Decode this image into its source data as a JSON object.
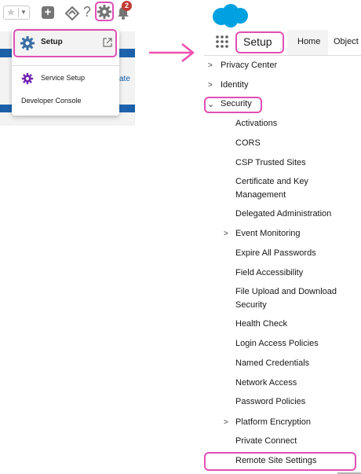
{
  "left": {
    "notification_count": "2",
    "peek_text": "ate",
    "menu": {
      "setup_label": "Setup",
      "service_setup_label": "Service Setup",
      "developer_console_label": "Developer Console"
    }
  },
  "right": {
    "header_title": "Setup",
    "tabs": [
      "Home",
      "Object"
    ],
    "tree": [
      {
        "label": "Privacy Center",
        "level": 0,
        "chevron": "right"
      },
      {
        "label": "Identity",
        "level": 0,
        "chevron": "right"
      },
      {
        "label": "Security",
        "level": 0,
        "chevron": "down"
      },
      {
        "label": "Activations",
        "level": 1
      },
      {
        "label": "CORS",
        "level": 1
      },
      {
        "label": "CSP Trusted Sites",
        "level": 1
      },
      {
        "label": "Certificate and Key Management",
        "level": 1
      },
      {
        "label": "Delegated Administration",
        "level": 1
      },
      {
        "label": "Event Monitoring",
        "level": 1,
        "chevron": "right"
      },
      {
        "label": "Expire All Passwords",
        "level": 1
      },
      {
        "label": "Field Accessibility",
        "level": 1
      },
      {
        "label": "File Upload and Download Security",
        "level": 1
      },
      {
        "label": "Health Check",
        "level": 1
      },
      {
        "label": "Login Access Policies",
        "level": 1
      },
      {
        "label": "Named Credentials",
        "level": 1
      },
      {
        "label": "Network Access",
        "level": 1
      },
      {
        "label": "Password Policies",
        "level": 1
      },
      {
        "label": "Platform Encryption",
        "level": 1,
        "chevron": "right"
      },
      {
        "label": "Private Connect",
        "level": 1
      },
      {
        "label": "Remote Site Settings",
        "level": 1
      }
    ]
  },
  "colors": {
    "highlight": "#e04fb4",
    "arrow": "#f04fb0",
    "brand_blue": "#00a1e0",
    "setup_icon": "#3a6ea5",
    "service_icon": "#7526b3",
    "badge": "#c23934"
  }
}
